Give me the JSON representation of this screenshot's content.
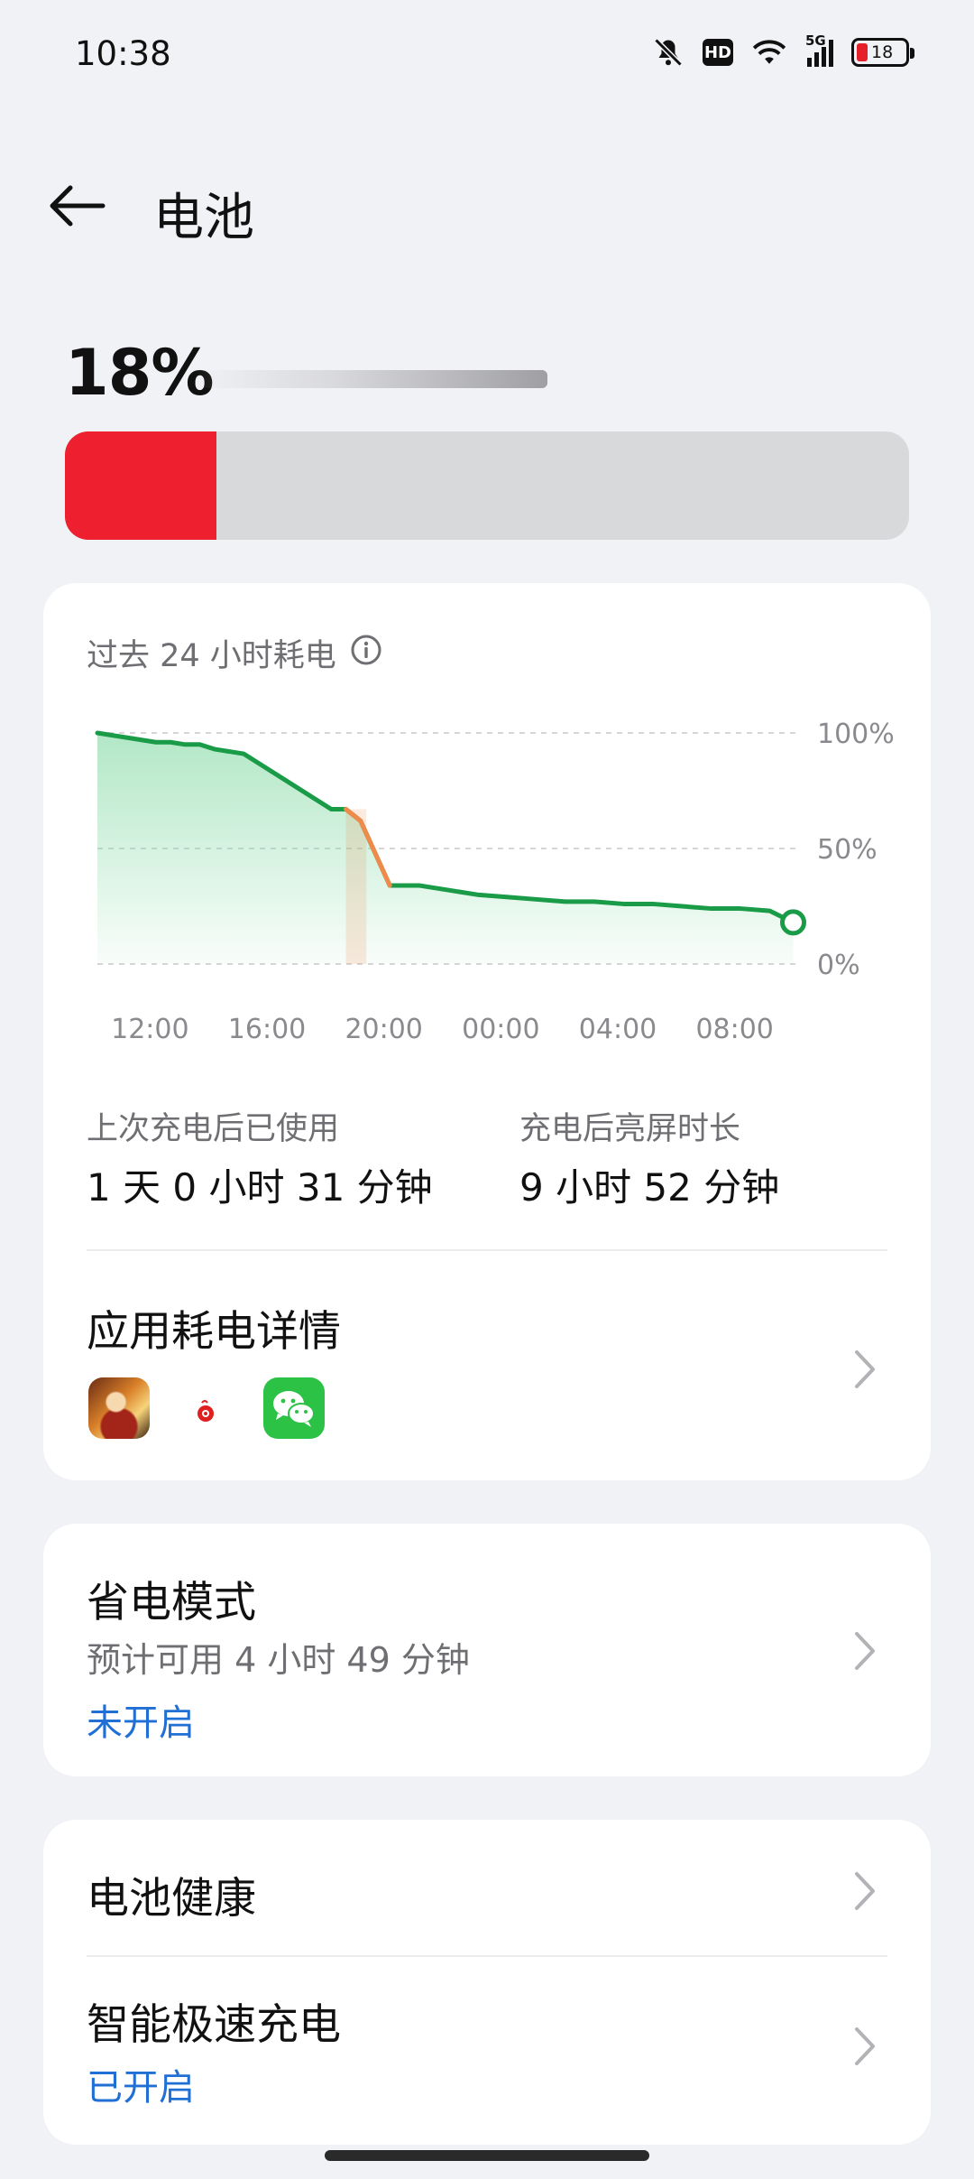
{
  "status_bar": {
    "time": "10:38",
    "network": "5G",
    "hd_label": "HD",
    "battery": "18",
    "icons": [
      "bell-off-icon",
      "hd-icon",
      "wifi-icon",
      "signal-icon",
      "battery-icon"
    ]
  },
  "header": {
    "title": "电池",
    "back_icon": "arrow-left-icon"
  },
  "battery": {
    "percent_label": "18%",
    "level_fraction": 0.18,
    "bar_color": "#ee1f2e"
  },
  "usage_card": {
    "title": "过去 24 小时耗电",
    "info_icon": "info-icon",
    "stats": [
      {
        "label": "上次充电后已使用",
        "value": "1 天 0 小时 31 分钟"
      },
      {
        "label": "充电后亮屏时长",
        "value": "9 小时 52 分钟"
      }
    ],
    "app_usage": {
      "title": "应用耗电详情",
      "apps": [
        "game-app-icon",
        "red-dot-app-icon",
        "wechat-icon"
      ]
    }
  },
  "chart_data": {
    "type": "area",
    "title": "过去 24 小时耗电",
    "xlabel": "",
    "ylabel": "",
    "x_tick_labels": [
      "12:00",
      "16:00",
      "20:00",
      "00:00",
      "04:00",
      "08:00"
    ],
    "y_tick_labels": [
      "100%",
      "50%",
      "0%"
    ],
    "ylim": [
      0,
      100
    ],
    "x_hours_from_start": [
      0,
      1,
      2,
      2.5,
      3,
      3.5,
      4,
      5,
      6,
      7,
      7.5,
      8,
      8.5,
      9,
      10,
      11,
      12,
      13,
      14,
      15,
      16,
      17,
      18,
      19,
      20,
      21,
      22,
      23,
      23.8
    ],
    "values": [
      100,
      98,
      96,
      96,
      95,
      95,
      93,
      91,
      83,
      75,
      71,
      67,
      67,
      62,
      34,
      34,
      32,
      30,
      29,
      28,
      27,
      27,
      26,
      26,
      25,
      24,
      24,
      23,
      18
    ],
    "highlight_range_hours": [
      8.5,
      9.2
    ],
    "line_color": "#1a9b48",
    "fill_color": "#7fd8a0",
    "highlight_color": "#f08a4b",
    "grid": true
  },
  "power_saving": {
    "title": "省电模式",
    "subtitle": "预计可用 4 小时 49 分钟",
    "status": "未开启"
  },
  "settings": [
    {
      "title": "电池健康"
    },
    {
      "title": "智能极速充电",
      "status": "已开启"
    }
  ],
  "accent_color": "#1f6fd4"
}
